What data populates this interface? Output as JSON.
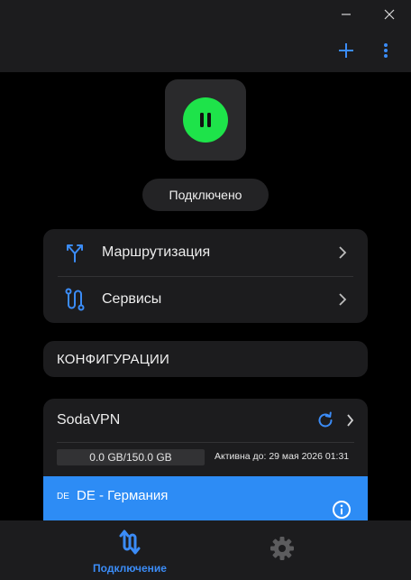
{
  "toolbar": {
    "minimize_icon": "minimize-icon",
    "close_icon": "close-icon",
    "add_icon": "plus-icon",
    "more_icon": "more-vertical-icon"
  },
  "connection": {
    "state_icon": "pause-icon",
    "status_label": "Подключено",
    "status_color": "#1ee34a"
  },
  "menu": {
    "items": [
      {
        "label": "Маршрутизация",
        "icon": "routing-split-icon"
      },
      {
        "label": "Сервисы",
        "icon": "services-route-icon"
      }
    ]
  },
  "configurations": {
    "header": "КОНФИГУРАЦИИ"
  },
  "subscription": {
    "name": "SodaVPN",
    "traffic": "0.0 GB/150.0 GB",
    "active_until": "Активна до: 29 мая 2026 01:31",
    "server": {
      "flag": "DE",
      "name": "DE - Германия"
    }
  },
  "bottom_nav": {
    "connection_label": "Подключение",
    "settings_icon": "gear-icon"
  },
  "colors": {
    "accent": "#3b8cf7",
    "selected_row": "#2d8cf5",
    "card": "#1c1c1e",
    "background": "#000000"
  }
}
